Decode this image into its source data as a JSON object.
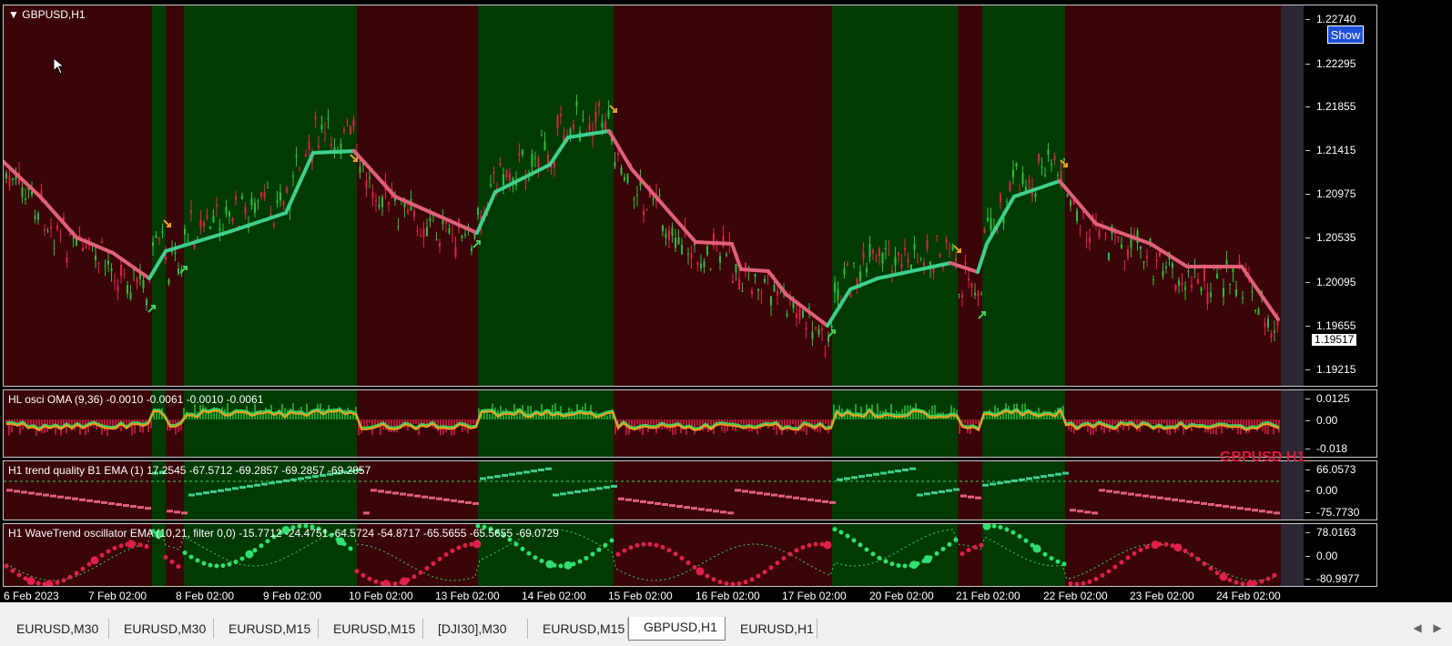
{
  "main": {
    "symbol_label": "GBPUSD,H1",
    "price_ticks": [
      "1.22740",
      "1.22295",
      "1.21855",
      "1.21415",
      "1.20975",
      "1.20535",
      "1.20095",
      "1.19655",
      "1.19215"
    ],
    "current_price": "1.19517",
    "show_button": "Show"
  },
  "indicators": [
    {
      "label": "HL osci OMA (9,36) -0.0010 -0.0061 -0.0010 -0.0061",
      "ticks": [
        "0.0125",
        "0.00",
        "-0.018"
      ]
    },
    {
      "label": "H1 trend quality B1  EMA (1) 17.2545 -67.5712 -69.2857 -69.2857 -69.2857",
      "ticks": [
        "66.0573",
        "0.00",
        "-75.7730"
      ]
    },
    {
      "label": "H1 WaveTrend oscillator EMA (10,21, filter 0,0) -15.7712 -24.4751 -64.5724 -54.8717 -65.5655 -65.5655 -69.0729",
      "ticks": [
        "78.0163",
        "0.00",
        "-80.9977"
      ]
    }
  ],
  "watermark": "GBPUSD H1",
  "time_axis": [
    "6 Feb 2023",
    "7 Feb 02:00",
    "8 Feb 02:00",
    "9 Feb 02:00",
    "10 Feb 02:00",
    "13 Feb 02:00",
    "14 Feb 02:00",
    "15 Feb 02:00",
    "16 Feb 02:00",
    "17 Feb 02:00",
    "20 Feb 02:00",
    "21 Feb 02:00",
    "22 Feb 02:00",
    "23 Feb 02:00",
    "24 Feb 02:00"
  ],
  "tabs": [
    "EURUSD,M30",
    "EURUSD,M30",
    "EURUSD,M15",
    "EURUSD,M15",
    "[DJI30],M30",
    "EURUSD,M15",
    "GBPUSD,H1",
    "EURUSD,H1"
  ],
  "active_tab": 6,
  "colors": {
    "bull_bg": "#013b03",
    "bear_bg": "#3a0508",
    "bull_line": "#3fcf8e",
    "bear_line": "#e0607a",
    "candle_up": "#2dbf3d",
    "candle_down": "#e0204a"
  }
}
